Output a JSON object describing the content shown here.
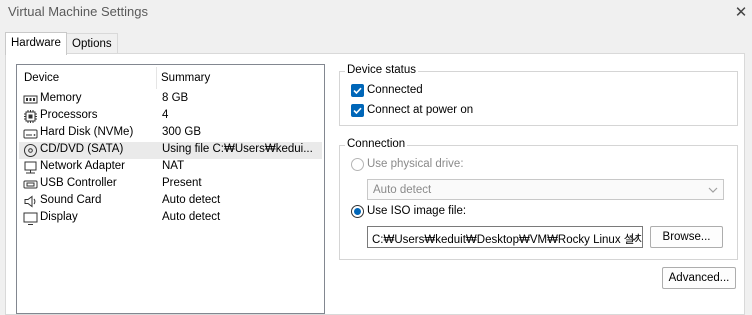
{
  "window": {
    "title": "Virtual Machine Settings"
  },
  "tabs": [
    {
      "label": "Hardware"
    },
    {
      "label": "Options"
    }
  ],
  "device_list": {
    "columns": {
      "device": "Device",
      "summary": "Summary"
    },
    "rows": [
      {
        "icon": "memory-icon",
        "device": "Memory",
        "summary": "8 GB"
      },
      {
        "icon": "processor-icon",
        "device": "Processors",
        "summary": "4"
      },
      {
        "icon": "hard-disk-icon",
        "device": "Hard Disk (NVMe)",
        "summary": "300 GB"
      },
      {
        "icon": "cd-dvd-icon",
        "device": "CD/DVD (SATA)",
        "summary": "Using file C:₩Users₩kedui..."
      },
      {
        "icon": "network-adapter-icon",
        "device": "Network Adapter",
        "summary": "NAT"
      },
      {
        "icon": "usb-controller-icon",
        "device": "USB Controller",
        "summary": "Present"
      },
      {
        "icon": "sound-card-icon",
        "device": "Sound Card",
        "summary": "Auto detect"
      },
      {
        "icon": "display-icon",
        "device": "Display",
        "summary": "Auto detect"
      }
    ],
    "selected_index": 3
  },
  "device_status": {
    "title": "Device status",
    "connected": {
      "label": "Connected",
      "checked": true
    },
    "connect_at_power_on": {
      "label": "Connect at power on",
      "checked": true
    }
  },
  "connection": {
    "title": "Connection",
    "physical_drive": {
      "label": "Use physical drive:",
      "selected": false,
      "enabled": false
    },
    "drive_select": {
      "value": "Auto detect"
    },
    "iso_image": {
      "label": "Use ISO image file:",
      "selected": true
    },
    "iso_path": "C:₩Users₩keduit₩Desktop₩VM₩Rocky Linux 설치",
    "browse_label": "Browse..."
  },
  "advanced_label": "Advanced...",
  "colors": {
    "accent": "#0066b8",
    "selection": "#eaeaea"
  }
}
